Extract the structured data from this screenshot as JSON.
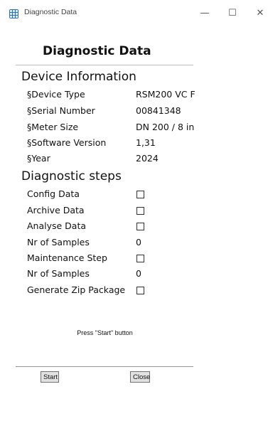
{
  "window": {
    "title": "Diagnostic Data",
    "minimize": "—",
    "maximize": "☐",
    "close": "✕"
  },
  "heading": "Diagnostic Data",
  "device_info": {
    "title": "Device Information",
    "rows": [
      {
        "label": "§Device Type",
        "value": "RSM200 VC F"
      },
      {
        "label": "§Serial Number",
        "value": "00841348"
      },
      {
        "label": "§Meter Size",
        "value": "DN 200 / 8 in"
      },
      {
        "label": "§Software Version",
        "value": "1,31"
      },
      {
        "label": "§Year",
        "value": "2024"
      }
    ]
  },
  "diagnostic_steps": {
    "title": "Diagnostic steps",
    "rows": [
      {
        "label": "Config Data",
        "type": "checkbox",
        "checked": false
      },
      {
        "label": "Archive Data",
        "type": "checkbox",
        "checked": false
      },
      {
        "label": "Analyse Data",
        "type": "checkbox",
        "checked": false
      },
      {
        "label": "Nr of Samples",
        "type": "value",
        "value": "0"
      },
      {
        "label": "Maintenance Step",
        "type": "checkbox",
        "checked": false
      },
      {
        "label": "Nr of Samples",
        "type": "value",
        "value": "0"
      },
      {
        "label": "Generate Zip Package",
        "type": "checkbox",
        "checked": false
      }
    ]
  },
  "status_text": "Press \"Start\" button",
  "buttons": {
    "start": "Start",
    "close": "Close"
  }
}
